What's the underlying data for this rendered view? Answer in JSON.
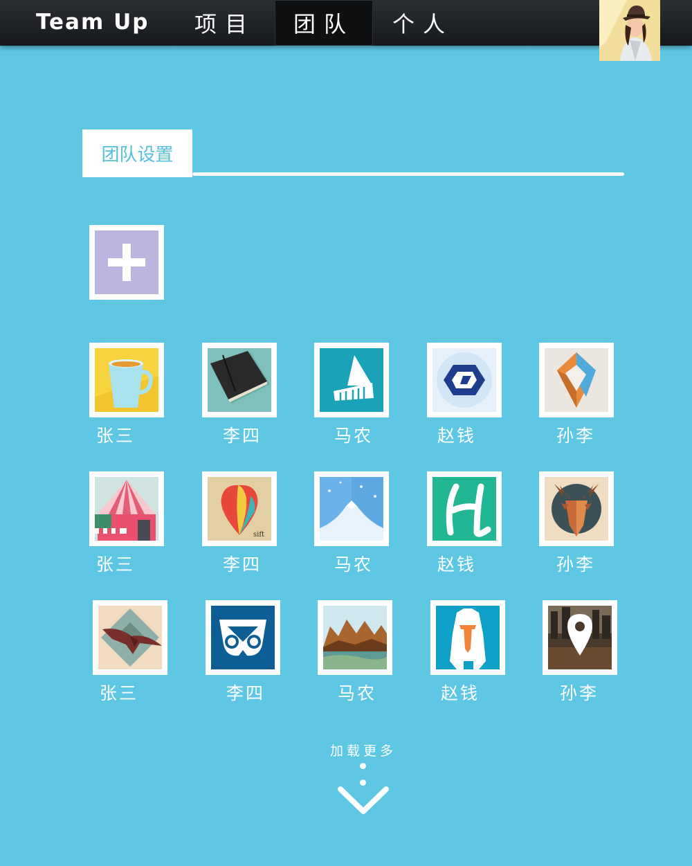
{
  "header": {
    "brand": "Team Up",
    "tabs": [
      {
        "label": "项目",
        "active": false
      },
      {
        "label": "团队",
        "active": true
      },
      {
        "label": "个人",
        "active": false
      }
    ]
  },
  "section": {
    "title": "团队设置"
  },
  "members": [
    {
      "name": "张三",
      "icon": "coffee-cup-icon"
    },
    {
      "name": "李四",
      "icon": "notebook-icon"
    },
    {
      "name": "马农",
      "icon": "building-icon"
    },
    {
      "name": "赵钱",
      "icon": "hexagon-logo-icon"
    },
    {
      "name": "孙李",
      "icon": "diamond-logo-icon"
    },
    {
      "name": "张三",
      "icon": "tent-shop-icon"
    },
    {
      "name": "李四",
      "icon": "hot-air-balloon-icon"
    },
    {
      "name": "马农",
      "icon": "mountain-icon"
    },
    {
      "name": "赵钱",
      "icon": "letter-h-icon"
    },
    {
      "name": "孙李",
      "icon": "deer-head-icon"
    },
    {
      "name": "张三",
      "icon": "eagle-icon"
    },
    {
      "name": "李四",
      "icon": "owl-logo-icon"
    },
    {
      "name": "马农",
      "icon": "landscape-icon"
    },
    {
      "name": "赵钱",
      "icon": "yeti-icon"
    },
    {
      "name": "孙李",
      "icon": "map-pin-icon"
    }
  ],
  "load_more": "加载更多",
  "colors": {
    "background": "#5ec8e4",
    "header": "#1d2024",
    "accent": "#55c0dc",
    "add_tile": "#b9b5de"
  }
}
